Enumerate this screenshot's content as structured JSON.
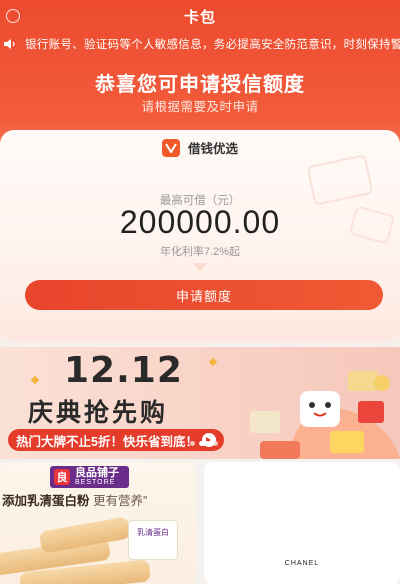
{
  "header": {
    "title": "卡包"
  },
  "notice": {
    "text": "银行账号、验证码等个人敏感信息，务必提高安全防范意识，时刻保持警惕"
  },
  "hero": {
    "headline": "恭喜您可申请授信额度",
    "subline": "请根据需要及时申请"
  },
  "card": {
    "brand_name": "借钱优选",
    "brand_logo": "v-logo-icon",
    "amount_label": "最高可借（元）",
    "amount": "200000.00",
    "rate_text": "年化利率7.2%起",
    "apply_label": "申请额度"
  },
  "banner": {
    "date": "12.12",
    "title": "庆典抢先购",
    "promo": "热门大牌不止5折！快乐省到底！",
    "active_slide": 1,
    "slide_count": 3
  },
  "products": [
    {
      "store_mark": "良",
      "store_name": "良品铺子",
      "store_name_en": "BESTORE",
      "title": "添加乳清蛋白粉",
      "subtitle": "更有营养”",
      "pack_label": "乳清蛋白"
    },
    {
      "brand": "CHANEL"
    }
  ],
  "colors": {
    "primary": "#ec4a2e",
    "button": "#e8452c",
    "promo_pill": "#e53b2a",
    "store_purple": "#6b2d8a"
  }
}
